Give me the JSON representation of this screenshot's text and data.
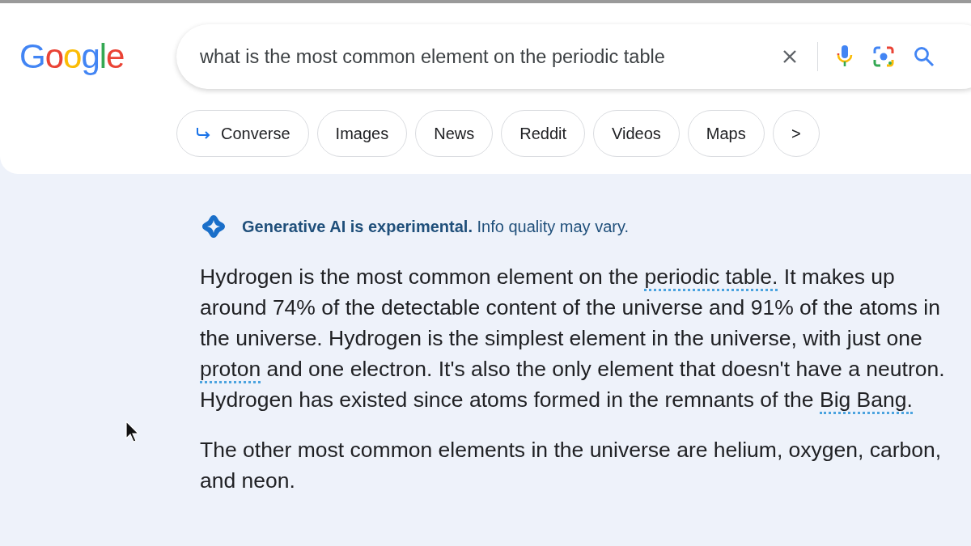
{
  "logo": "Google",
  "search": {
    "value": "what is the most common element on the periodic table"
  },
  "chips": [
    {
      "label": "Converse",
      "kind": "arrow"
    },
    {
      "label": "Images",
      "kind": "plain"
    },
    {
      "label": "News",
      "kind": "plain"
    },
    {
      "label": "Reddit",
      "kind": "plain"
    },
    {
      "label": "Videos",
      "kind": "plain"
    },
    {
      "label": "Maps",
      "kind": "plain"
    },
    {
      "label": ">",
      "kind": "more"
    }
  ],
  "ai_notice": "**Generative AI is experimental.** Info quality may vary.",
  "paragraphs": [
    [
      {
        "text": "Hydrogen is the most common element on the ",
        "link": false
      },
      {
        "text": "periodic table.",
        "link": true
      },
      {
        "text": " It makes up around 74% of the detectable content of the universe and 91% of the atoms in the universe. Hydrogen is the simplest element in the universe, with just one ",
        "link": false
      },
      {
        "text": "proton",
        "link": true
      },
      {
        "text": " and one electron. It's also the only element that doesn't have a neutron. Hydrogen has existed since atoms formed in the remnants of the ",
        "link": false
      },
      {
        "text": "Big Bang.",
        "link": true
      }
    ],
    [
      {
        "text": "The other most common elements in the universe are helium, oxygen, carbon, and neon.",
        "link": false
      }
    ]
  ]
}
